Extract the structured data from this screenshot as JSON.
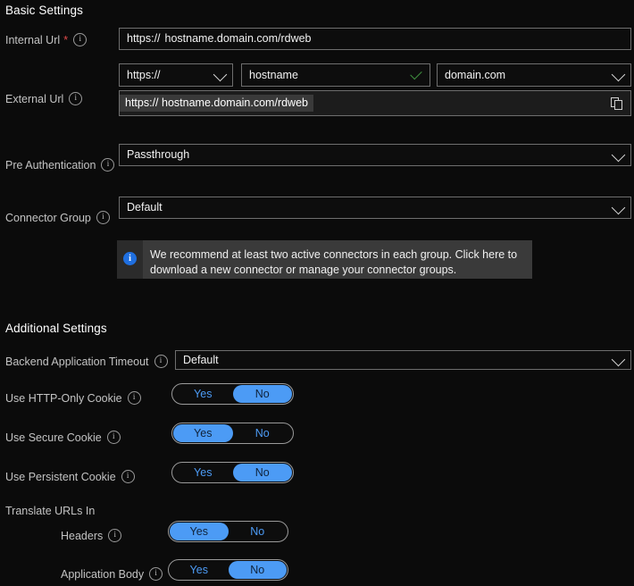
{
  "sections": {
    "basic": {
      "title": "Basic Settings"
    },
    "additional": {
      "title": "Additional Settings"
    }
  },
  "colors": {
    "accent": "#4c9bf5",
    "required": "#e04a4a",
    "validation_ok": "#3f8f3f",
    "banner_bg": "#3a3a3a",
    "page_bg": "#0b0b0b"
  },
  "basic_fields": {
    "internal_url": {
      "label": "Internal Url",
      "required": true,
      "scheme": "https://",
      "value": "hostname.domain.com/rdweb"
    },
    "url_parts": {
      "scheme_select": "https://",
      "hostname_input": "hostname",
      "hostname_placeholder": "hostname",
      "domain_select": "domain.com"
    },
    "external_url": {
      "label": "External Url",
      "scheme": "https://",
      "value": "hostname.domain.com/rdweb",
      "copy_label": "copy-to-clipboard"
    },
    "pre_authentication": {
      "label": "Pre Authentication",
      "value": "Passthrough"
    },
    "connector_group": {
      "label": "Connector Group",
      "value": "Default"
    },
    "banner": {
      "line1": "We recommend at least two active connectors in each group. Click here to",
      "line2": "download a new connector or manage your connector groups."
    }
  },
  "additional_fields": {
    "backend_timeout": {
      "label": "Backend Application Timeout",
      "value": "Default"
    },
    "toggles": [
      {
        "label": "Use HTTP-Only Cookie",
        "yes": "Yes",
        "no": "No",
        "selected": "No"
      },
      {
        "label": "Use Secure Cookie",
        "yes": "Yes",
        "no": "No",
        "selected": "Yes"
      },
      {
        "label": "Use Persistent Cookie",
        "yes": "Yes",
        "no": "No",
        "selected": "No"
      }
    ],
    "translate_group": {
      "label": "Translate URLs In",
      "items": [
        {
          "label": "Headers",
          "yes": "Yes",
          "no": "No",
          "selected": "Yes"
        },
        {
          "label": "Application Body",
          "yes": "Yes",
          "no": "No",
          "selected": "No"
        }
      ]
    }
  }
}
